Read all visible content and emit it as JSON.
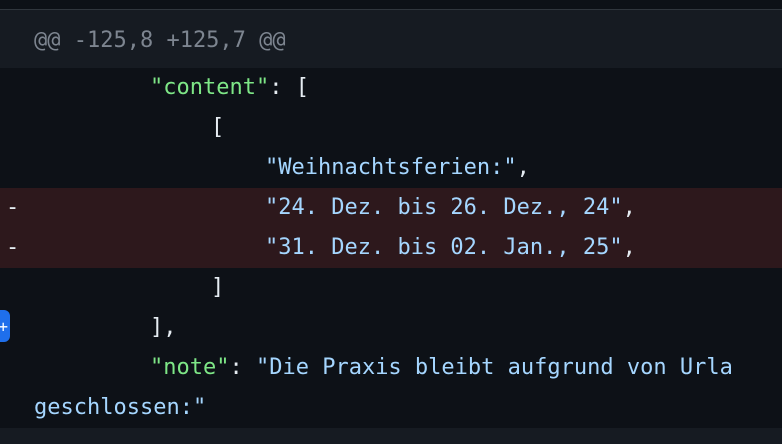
{
  "hunk_header": "@@ -125,8 +125,7 @@",
  "lines": [
    {
      "type": "context",
      "key": "\"content\"",
      "rest": ": ["
    },
    {
      "type": "context",
      "text": "["
    },
    {
      "type": "context",
      "str": "\"Weihnachtsferien:\"",
      "rest": ","
    },
    {
      "type": "deletion",
      "marker": "-",
      "str": "\"24. Dez. bis 26. Dez., 24\"",
      "rest": ","
    },
    {
      "type": "deletion",
      "marker": "-",
      "str": "\"31. Dez. bis 02. Jan., 25\"",
      "rest": ","
    },
    {
      "type": "context",
      "text": "]"
    },
    {
      "type": "context",
      "text": "],"
    },
    {
      "type": "context",
      "key": "\"note\"",
      "rest": ": ",
      "str": "\"Die Praxis bleibt aufgrund von Urla"
    },
    {
      "type": "context",
      "str": "geschlossen:\""
    }
  ],
  "comment_button_icon": "plus-icon",
  "colors": {
    "background": "#0d1117",
    "hunk_background": "#161b22",
    "deletion_background": "#2d181c",
    "key": "#7ee787",
    "string": "#a5d6ff",
    "accent": "#1f6feb"
  }
}
